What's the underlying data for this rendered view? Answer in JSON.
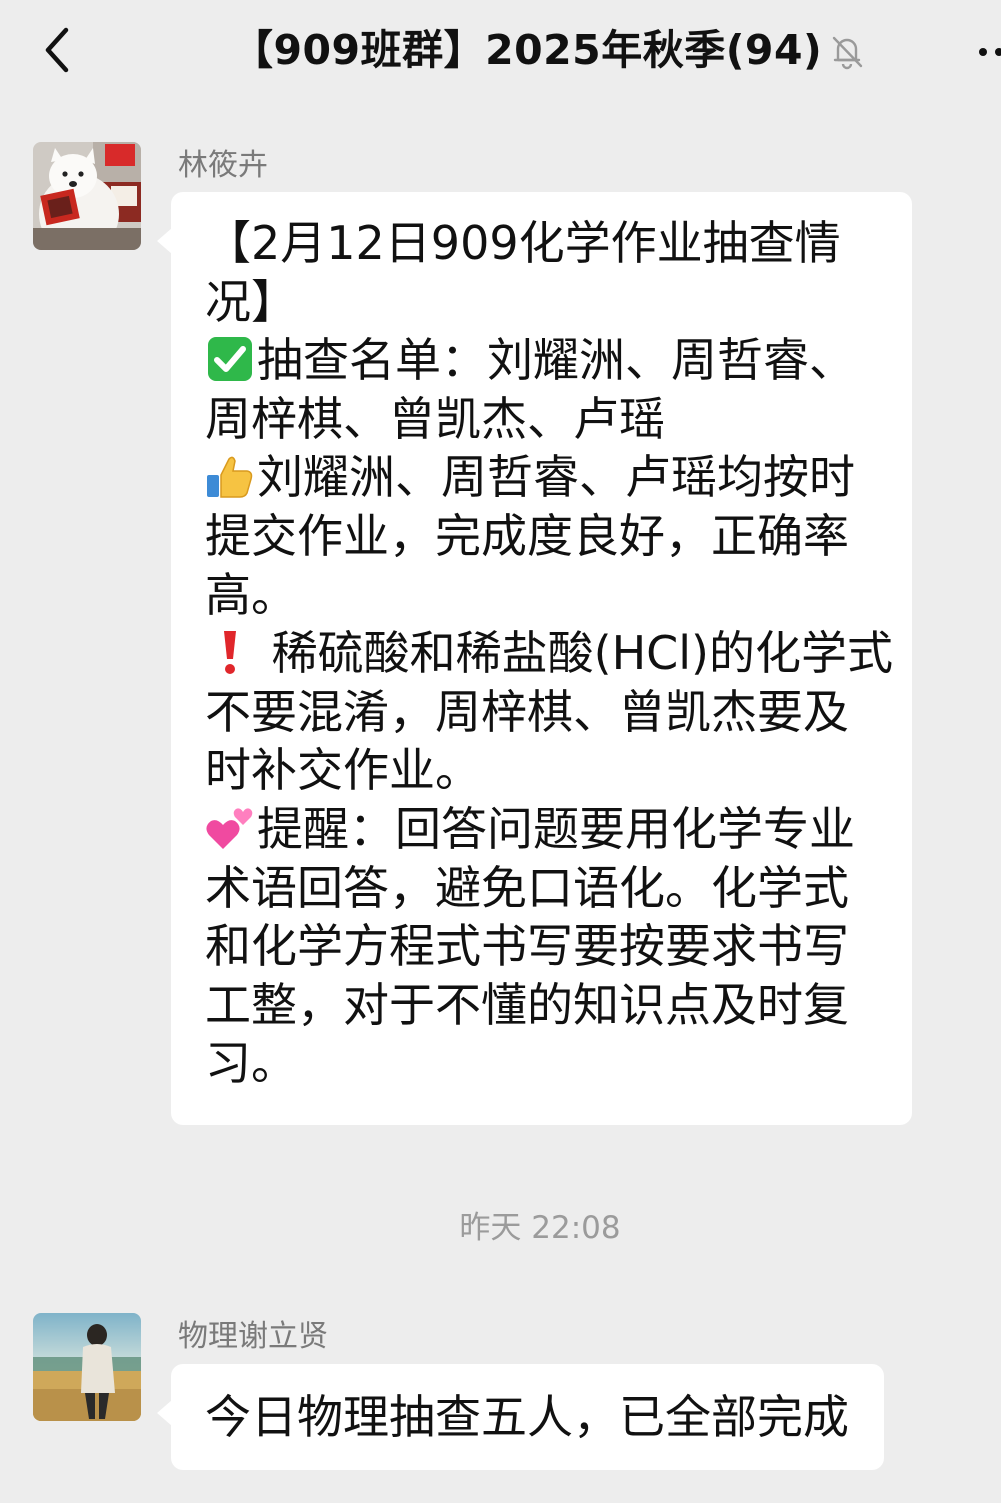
{
  "header": {
    "title": "【909班群】2025年秋季(94)",
    "back_icon": "chevron-left-icon",
    "mute_icon": "bell-off-icon",
    "more_icon": "more-dots-icon"
  },
  "messages": [
    {
      "sender": "林筱卉",
      "lines": [
        {
          "emoji": null,
          "text": "【2月12日909化学作业抽查情"
        },
        {
          "emoji": null,
          "text": "况】"
        },
        {
          "emoji": "check-mark-icon",
          "text": "抽查名单：刘耀洲、周哲睿、"
        },
        {
          "emoji": null,
          "text": "周梓棋、曾凯杰、卢瑶"
        },
        {
          "emoji": "thumbs-up-icon",
          "text": "刘耀洲、周哲睿、卢瑶均按时"
        },
        {
          "emoji": null,
          "text": "提交作业，完成度良好，正确率"
        },
        {
          "emoji": null,
          "text": "高。"
        },
        {
          "emoji": "exclamation-icon",
          "text": " 稀硫酸和稀盐酸(HCl)的化学式"
        },
        {
          "emoji": null,
          "text": "不要混淆，周梓棋、曾凯杰要及"
        },
        {
          "emoji": null,
          "text": "时补交作业。"
        },
        {
          "emoji": "two-hearts-icon",
          "text": "提醒：回答问题要用化学专业"
        },
        {
          "emoji": null,
          "text": "术语回答，避免口语化。化学式"
        },
        {
          "emoji": null,
          "text": "和化学方程式书写要按要求书写"
        },
        {
          "emoji": null,
          "text": "工整，对于不懂的知识点及时复"
        },
        {
          "emoji": null,
          "text": "习。"
        }
      ]
    },
    {
      "sender": "物理谢立贤",
      "lines": [
        {
          "emoji": null,
          "text": "今日物理抽查五人，已全部完成"
        }
      ]
    }
  ],
  "timestamp": "昨天 22:08",
  "colors": {
    "background": "#ededed",
    "bubble": "#ffffff",
    "name_text": "#7a7a7a",
    "timestamp_text": "#9b9b9b",
    "check_green": "#2fb84a",
    "exclamation_red": "#e0262b",
    "heart_pink": "#f04aa0"
  }
}
